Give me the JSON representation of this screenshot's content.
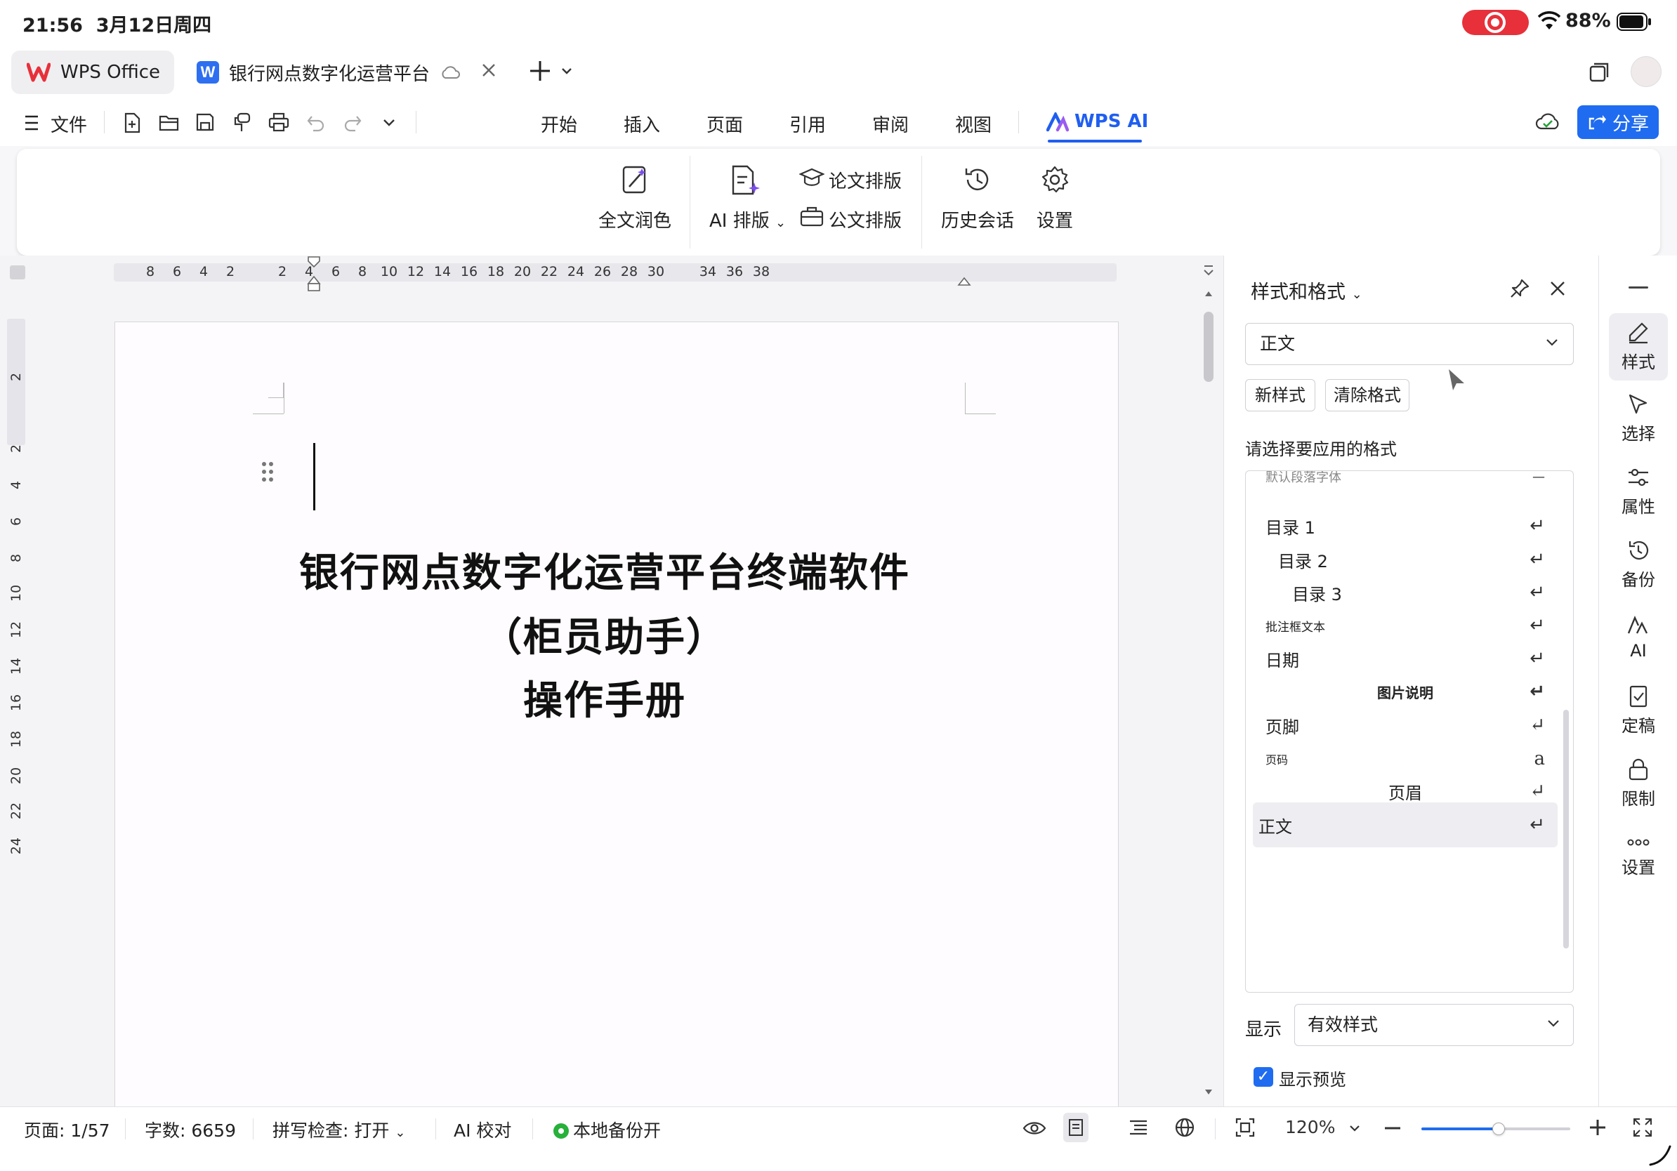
{
  "status_bar": {
    "time": "21:56",
    "date": "3月12日周四",
    "battery": "88%"
  },
  "tabs": [
    {
      "label": "WPS Office"
    },
    {
      "label": "银行网点数字化运营平台"
    }
  ],
  "menu": {
    "file": "文件",
    "items": [
      "开始",
      "插入",
      "页面",
      "引用",
      "审阅",
      "视图"
    ],
    "active": "WPS AI",
    "share": "分享"
  },
  "ribbon": {
    "polish": "全文润色",
    "ai_layout": "AI 排版",
    "thesis_layout": "论文排版",
    "official_layout": "公文排版",
    "history": "历史会话",
    "settings": "设置"
  },
  "ruler": {
    "h_ticks": [
      "8",
      "6",
      "4",
      "2",
      "2",
      "4",
      "6",
      "8",
      "10",
      "12",
      "14",
      "16",
      "18",
      "20",
      "22",
      "24",
      "26",
      "28",
      "30",
      "34",
      "36",
      "38"
    ],
    "v_ticks": [
      "2",
      "2",
      "4",
      "6",
      "8",
      "10",
      "12",
      "14",
      "16",
      "18",
      "20",
      "22",
      "24"
    ]
  },
  "document": {
    "title_lines": [
      "银行网点数字化运营平台终端软件",
      "（柜员助手）",
      "操作手册"
    ]
  },
  "style_panel": {
    "title": "样式和格式",
    "current_style": "正文",
    "new_style": "新样式",
    "clear_format": "清除格式",
    "prompt": "请选择要应用的格式",
    "partial_item": "默认段落字体",
    "items": [
      {
        "label": "目录  1",
        "mark": "↵"
      },
      {
        "label": "目录  2",
        "mark": "↵"
      },
      {
        "label": "目录  3",
        "mark": "↵"
      },
      {
        "label": "批注框文本",
        "mark": "↵"
      },
      {
        "label": "日期",
        "mark": "↵"
      },
      {
        "label": "图片说明",
        "mark": "↵"
      },
      {
        "label": "页脚",
        "mark": "↵"
      },
      {
        "label": "页码",
        "mark": "a"
      },
      {
        "label": "页眉",
        "mark": "↵"
      },
      {
        "label": "正文",
        "mark": "↵"
      }
    ],
    "show_label": "显示",
    "show_value": "有效样式",
    "preview_label": "显示预览"
  },
  "side_tools": [
    "样式",
    "选择",
    "属性",
    "备份",
    "AI",
    "定稿",
    "限制",
    "设置"
  ],
  "bottom_bar": {
    "page": "页面: 1/57",
    "words": "字数: 6659",
    "spell": "拼写检查: 打开",
    "ai_proof": "AI 校对",
    "backup": "本地备份开",
    "zoom": "120%",
    "zoom_fraction": 0.52
  },
  "colors": {
    "accent": "#1f6cf0",
    "record": "#e8303a",
    "backup_ok": "#27b03a"
  }
}
